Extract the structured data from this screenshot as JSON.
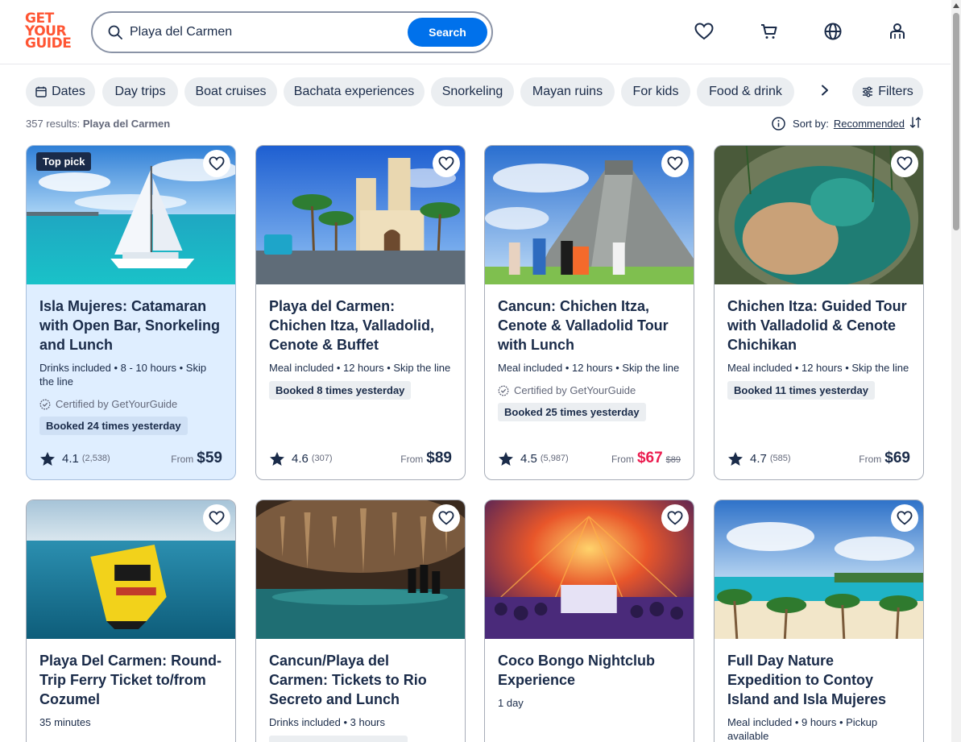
{
  "header": {
    "logo_lines": [
      "GET",
      "YOUR",
      "GUIDE"
    ],
    "search_value": "Playa del Carmen",
    "search_button": "Search",
    "icons": [
      "heart-icon",
      "cart-icon",
      "globe-icon",
      "profile-icon"
    ]
  },
  "chips": [
    {
      "label": "Dates",
      "icon": "calendar-icon"
    },
    {
      "label": "Day trips"
    },
    {
      "label": "Boat cruises"
    },
    {
      "label": "Bachata experiences"
    },
    {
      "label": "Snorkeling"
    },
    {
      "label": "Mayan ruins"
    },
    {
      "label": "For kids"
    },
    {
      "label": "Food & drink"
    }
  ],
  "filters_label": "Filters",
  "results": {
    "count_text": "357 results:",
    "query": "Playa del Carmen"
  },
  "sort": {
    "label": "Sort by:",
    "value": "Recommended"
  },
  "cards": [
    {
      "tag": "Top pick",
      "title": "Isla Mujeres: Catamaran with Open Bar, Snorkeling and Lunch",
      "meta": "Drinks included • 8 - 10 hours • Skip the line",
      "certified": "Certified by GetYourGuide",
      "booked": "Booked 24 times yesterday",
      "rating": "4.1",
      "reviews": "(2,538)",
      "from": "From",
      "price": "$59",
      "old_price": ""
    },
    {
      "tag": "",
      "title": "Playa del Carmen: Chichen Itza, Valladolid, Cenote & Buffet",
      "meta": "Meal included • 12 hours • Skip the line",
      "certified": "",
      "booked": "Booked 8 times yesterday",
      "rating": "4.6",
      "reviews": "(307)",
      "from": "From",
      "price": "$89",
      "old_price": ""
    },
    {
      "tag": "",
      "title": "Cancun: Chichen Itza, Cenote & Valladolid Tour with Lunch",
      "meta": "Meal included • 12 hours • Skip the line",
      "certified": "Certified by GetYourGuide",
      "booked": "Booked 25 times yesterday",
      "rating": "4.5",
      "reviews": "(5,987)",
      "from": "From",
      "price": "$67",
      "old_price": "$89"
    },
    {
      "tag": "",
      "title": "Chichen Itza: Guided Tour with Valladolid & Cenote Chichikan",
      "meta": "Meal included • 12 hours • Skip the line",
      "certified": "",
      "booked": "Booked 11 times yesterday",
      "rating": "4.7",
      "reviews": "(585)",
      "from": "From",
      "price": "$69",
      "old_price": ""
    },
    {
      "title": "Playa Del Carmen: Round-Trip Ferry Ticket to/from Cozumel",
      "meta": "35 minutes"
    },
    {
      "title": "Cancun/Playa del Carmen: Tickets to Rio Secreto and Lunch",
      "meta": "Drinks included • 3 hours"
    },
    {
      "title": "Coco Bongo Nightclub Experience",
      "meta": "1 day"
    },
    {
      "title": "Full Day Nature Expedition to Contoy Island and Isla Mujeres",
      "meta": "Meal included • 9 hours • Pickup available"
    }
  ],
  "colors": {
    "brand": "#ff5533",
    "primary": "#0071eb",
    "text": "#1a2b49",
    "sale": "#eb1c4f",
    "highlight_card": "#dfeeff"
  }
}
